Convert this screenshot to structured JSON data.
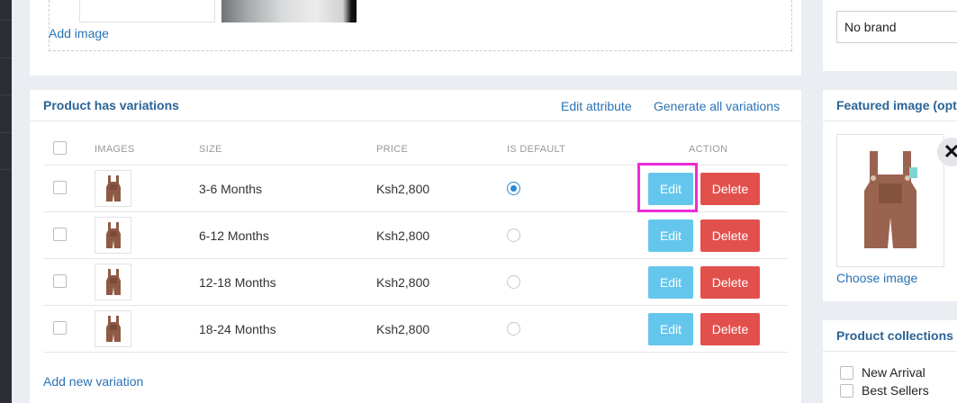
{
  "images_section": {
    "add_image_label": "Add image"
  },
  "variations": {
    "title": "Product has variations",
    "edit_attribute_label": "Edit attribute",
    "generate_all_label": "Generate all variations",
    "columns": {
      "images": "IMAGES",
      "size": "SIZE",
      "price": "PRICE",
      "is_default": "IS DEFAULT",
      "action": "ACTION"
    },
    "rows": [
      {
        "size": "3-6 Months",
        "price": "Ksh2,800",
        "is_default": true,
        "edit_label": "Edit",
        "delete_label": "Delete"
      },
      {
        "size": "6-12 Months",
        "price": "Ksh2,800",
        "is_default": false,
        "edit_label": "Edit",
        "delete_label": "Delete"
      },
      {
        "size": "12-18 Months",
        "price": "Ksh2,800",
        "is_default": false,
        "edit_label": "Edit",
        "delete_label": "Delete"
      },
      {
        "size": "18-24 Months",
        "price": "Ksh2,800",
        "is_default": false,
        "edit_label": "Edit",
        "delete_label": "Delete"
      }
    ],
    "add_variation_label": "Add new variation"
  },
  "brand": {
    "selected": "No brand"
  },
  "featured_image": {
    "title": "Featured image (optio",
    "choose_label": "Choose image",
    "close_icon": "close-icon"
  },
  "collections": {
    "title": "Product collections",
    "items": [
      {
        "label": "New Arrival",
        "checked": false
      },
      {
        "label": "Best Sellers",
        "checked": false
      }
    ]
  },
  "colors": {
    "link": "#2a73b5",
    "edit_button": "#64c6ec",
    "delete_button": "#e2504c",
    "highlight": "#ee2bd4"
  }
}
